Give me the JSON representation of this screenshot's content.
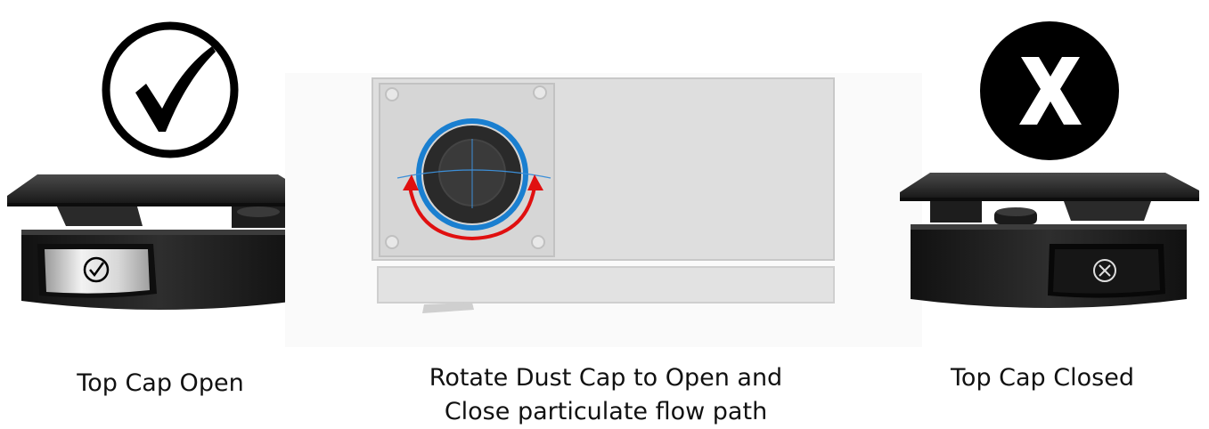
{
  "captions": {
    "left": "Top Cap Open",
    "center_line1": "Rotate Dust Cap to Open and",
    "center_line2": "Close particulate flow path",
    "right": "Top Cap Closed"
  },
  "icons": {
    "open_status": "check-circle-icon",
    "closed_status": "x-circle-icon",
    "rotate_arrow": "rotate-arrow-icon"
  },
  "colors": {
    "cap_black": "#1c1c1c",
    "device_gray": "#dcdcdc",
    "ring_blue": "#1a7fd0",
    "arrow_red": "#e01010"
  }
}
